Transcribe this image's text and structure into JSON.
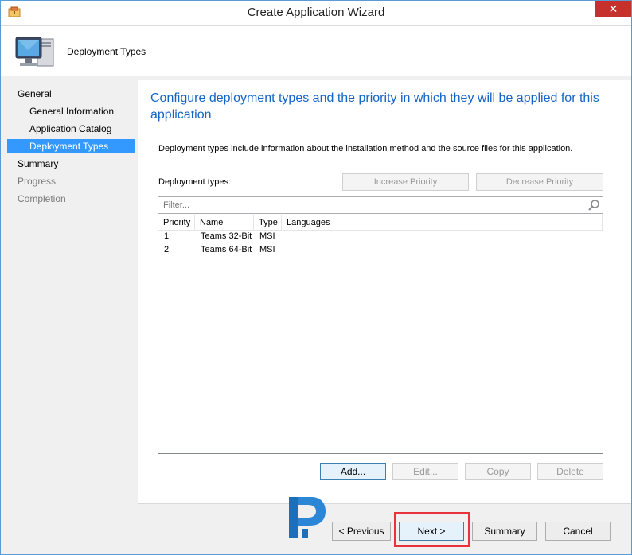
{
  "window": {
    "title": "Create Application Wizard",
    "close_label": "✕"
  },
  "header": {
    "title": "Deployment Types"
  },
  "sidebar": {
    "items": [
      {
        "label": "General"
      },
      {
        "label": "General Information"
      },
      {
        "label": "Application Catalog"
      },
      {
        "label": "Deployment Types"
      },
      {
        "label": "Summary"
      },
      {
        "label": "Progress"
      },
      {
        "label": "Completion"
      }
    ]
  },
  "main": {
    "heading": "Configure deployment types and the priority in which they will be applied for this application",
    "description": "Deployment types include information about the installation method and the source files for this application.",
    "deployment_types_label": "Deployment types:",
    "increase_priority": "Increase Priority",
    "decrease_priority": "Decrease Priority",
    "filter_placeholder": "Filter...",
    "columns": [
      "Priority",
      "Name",
      "Type",
      "Languages"
    ],
    "rows": [
      {
        "priority": "1",
        "name": "Teams 32-Bit",
        "type": "MSI",
        "languages": ""
      },
      {
        "priority": "2",
        "name": "Teams 64-Bit",
        "type": "MSI",
        "languages": ""
      }
    ],
    "add": "Add...",
    "edit": "Edit...",
    "copy": "Copy",
    "delete": "Delete"
  },
  "footer": {
    "previous": "< Previous",
    "next": "Next >",
    "summary": "Summary",
    "cancel": "Cancel"
  },
  "colors": {
    "accent": "#3399ff",
    "heading": "#1464c8",
    "highlight": "#e8323c"
  }
}
